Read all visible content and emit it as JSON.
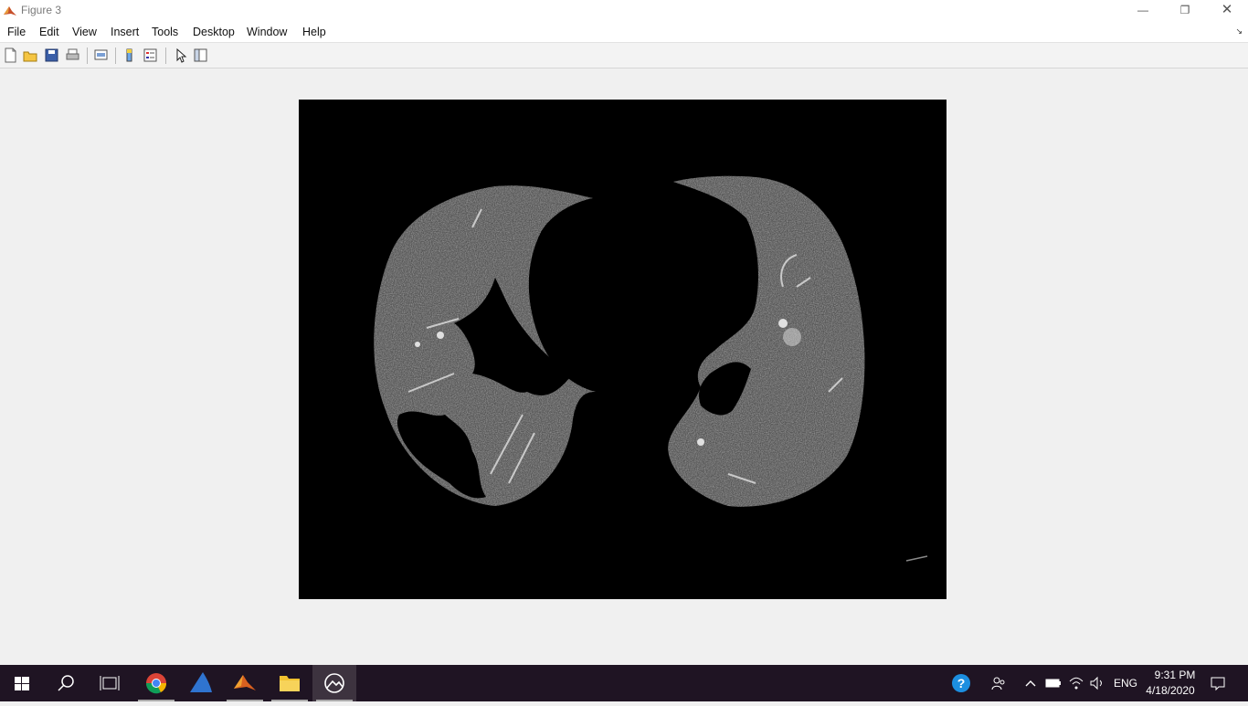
{
  "window": {
    "title": "Figure 3",
    "controls": {
      "minimize": "—",
      "restore": "❐",
      "close": "✕"
    }
  },
  "menu": {
    "items": [
      "File",
      "Edit",
      "View",
      "Insert",
      "Tools",
      "Desktop",
      "Window",
      "Help"
    ],
    "dock_arrow": "↘"
  },
  "toolbar": {
    "buttons": [
      "new-figure-icon",
      "open-file-icon",
      "save-icon",
      "print-icon",
      "link-plot-icon",
      "colorbar-icon",
      "legend-icon",
      "edit-plot-pointer-icon",
      "property-inspector-icon"
    ]
  },
  "figure": {
    "content": "image display (binary-masked chest CT lung slice)"
  },
  "taskbar": {
    "apps": [
      "start-icon",
      "search-icon",
      "task-view-icon",
      "chrome-icon",
      "app-shark-icon",
      "matlab-icon",
      "file-explorer-icon",
      "photos-icon"
    ],
    "tray": {
      "language": "ENG",
      "time": "9:31 PM",
      "date": "4/18/2020"
    }
  },
  "colors": {
    "taskbar": "#1f1423",
    "figure_bg": "#f0f0f0",
    "image_bg": "#000000"
  }
}
